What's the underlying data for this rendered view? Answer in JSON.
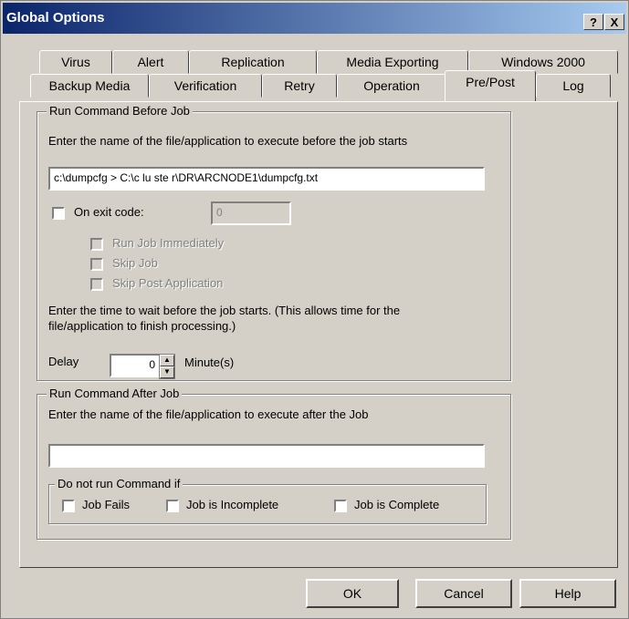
{
  "window": {
    "title": "Global Options",
    "help_label": "?",
    "close_label": "X"
  },
  "tabs": {
    "row1": [
      "Virus",
      "Alert",
      "Replication",
      "Media Exporting",
      "Windows 2000"
    ],
    "row2": [
      "Backup Media",
      "Verification",
      "Retry",
      "Operation",
      "Pre/Post",
      "Log"
    ],
    "active": "Pre/Post"
  },
  "before": {
    "legend": "Run Command Before Job",
    "instruction": "Enter the name of the file/application to execute before the job starts",
    "command": "c:\\dumpcfg > C:\\c lu ste r\\DR\\ARCNODE1\\dumpcfg.txt",
    "on_exit_label": "On exit code:",
    "exit_code": "0",
    "run_job_immediately": "Run Job Immediately",
    "skip_job": "Skip Job",
    "skip_post_app": "Skip Post Application",
    "wait_text_1": "Enter the time to wait before the job starts. (This allows time for the",
    "wait_text_2": "file/application to finish processing.)",
    "delay_label": "Delay",
    "delay_value": "0",
    "minutes_label": "Minute(s)"
  },
  "after": {
    "legend": "Run Command After Job",
    "instruction": "Enter the name of the file/application to execute after the Job",
    "command": "",
    "do_not_run_legend": "Do not run Command if",
    "job_fails": "Job Fails",
    "job_incomplete": "Job is Incomplete",
    "job_complete": "Job is Complete"
  },
  "buttons": {
    "ok": "OK",
    "cancel": "Cancel",
    "help": "Help"
  }
}
